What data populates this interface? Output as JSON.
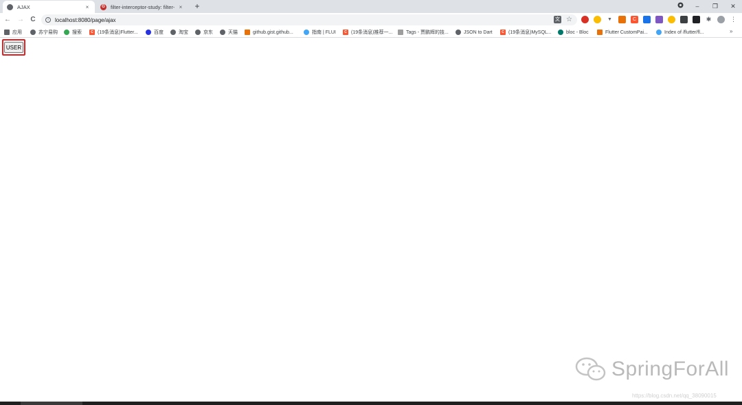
{
  "tabs": [
    {
      "title": "AJAX",
      "close": "×"
    },
    {
      "title": "filter-interceptor-study: filter-i",
      "close": "×"
    }
  ],
  "new_tab": "+",
  "window_controls": {
    "minimize": "–",
    "maximize": "❐",
    "close": "✕"
  },
  "nav": {
    "back": "←",
    "forward": "→",
    "reload": "C"
  },
  "address": {
    "url": "localhost:8080/page/ajax",
    "info": "i"
  },
  "bookmarks": [
    {
      "label": "应用",
      "icon": "apps-grid-icon"
    },
    {
      "label": "苏宁易购",
      "icon": "globe-icon"
    },
    {
      "label": "搜索",
      "icon": "search-icon"
    },
    {
      "label": "(19条消息)Flutter...",
      "icon": "csdn-icon"
    },
    {
      "label": "百度",
      "icon": "baidu-icon"
    },
    {
      "label": "淘宝",
      "icon": "globe-icon"
    },
    {
      "label": "京东",
      "icon": "globe-icon"
    },
    {
      "label": "天猫",
      "icon": "globe-icon"
    },
    {
      "label": "github.gist.github...",
      "icon": "bookmark-icon"
    },
    {
      "label": "指南 | FLUI",
      "icon": "flutter-icon"
    },
    {
      "label": "(19条消息)推荐一...",
      "icon": "csdn-icon"
    },
    {
      "label": "Tags - 贾鹏辉的技...",
      "icon": "tags-icon"
    },
    {
      "label": "JSON to Dart",
      "icon": "globe-icon"
    },
    {
      "label": "(19条消息)MySQL...",
      "icon": "csdn-icon"
    },
    {
      "label": "bloc - Bloc",
      "icon": "bloc-icon"
    },
    {
      "label": "Flutter CustomPai...",
      "icon": "bookmark-icon"
    },
    {
      "label": "Index of /flutter/fl...",
      "icon": "flutter-icon"
    }
  ],
  "bookmarks_more": "»",
  "page": {
    "button_label": "USER"
  },
  "watermark": {
    "text": "SpringForAll",
    "csdn": "https://blog.csdn.net/qq_38090015"
  },
  "colors": {
    "highlight": "#e02020",
    "csdn": "#fc5531"
  }
}
